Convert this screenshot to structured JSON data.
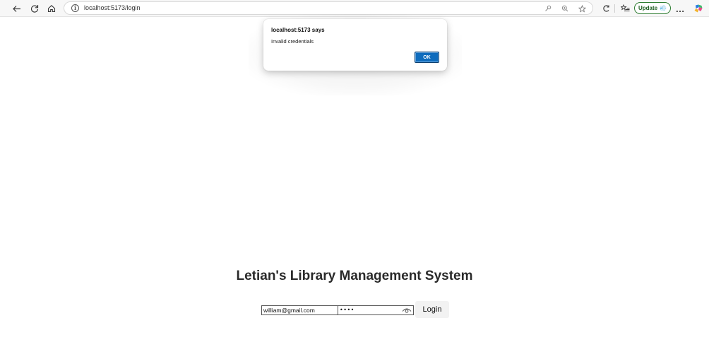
{
  "browser": {
    "url": "localhost:5173/login",
    "update_label": "Update",
    "update_emoji": "💨",
    "more_label": "…",
    "icons": {
      "back": "back-arrow-icon",
      "refresh": "refresh-icon",
      "home": "home-icon",
      "site_info": "info-icon",
      "key": "key-icon",
      "zoom": "zoom-icon",
      "favorite": "star-icon",
      "collections": "collections-icon",
      "favorites_list": "favorites-list-icon",
      "copilot": "copilot-icon"
    }
  },
  "page": {
    "title": "Letian's Library Management System",
    "email_value": "william@gmail.com",
    "password_value": "••••",
    "login_label": "Login"
  },
  "dialog": {
    "title": "localhost:5173 says",
    "message": "Invalid credentials",
    "ok_label": "OK",
    "accent": "#0f6cbd"
  }
}
